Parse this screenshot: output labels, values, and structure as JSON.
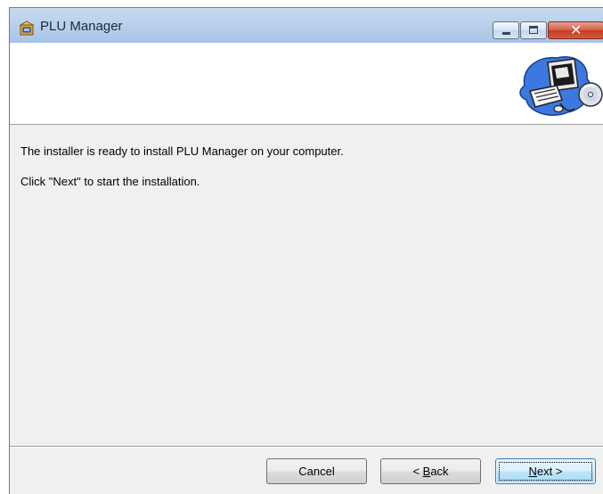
{
  "window": {
    "title": "PLU Manager",
    "close_glyph": "✕"
  },
  "content": {
    "line1": "The installer is ready to install PLU Manager on your computer.",
    "line2": "Click \"Next\" to start the installation."
  },
  "buttons": {
    "cancel_label": "Cancel",
    "back_prefix": "< ",
    "back_key": "B",
    "back_rest": "ack",
    "next_key": "N",
    "next_rest": "ext >"
  },
  "icons": {
    "app_icon": "installer-box-icon",
    "banner_art": "computer-with-disc-icon"
  },
  "colors": {
    "titlebar": "#b9d1ec",
    "close_button": "#c23d22",
    "dialog_bg": "#f0f0f0",
    "default_button_border": "#3c7fb1"
  }
}
